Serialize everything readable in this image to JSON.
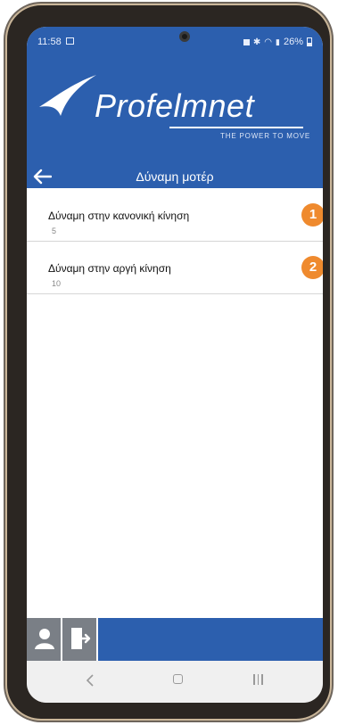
{
  "status": {
    "time": "11:58",
    "battery": "26%"
  },
  "brand": {
    "name": "Profelmnet",
    "tagline": "THE POWER TO MOVE"
  },
  "header": {
    "title": "Δύναμη μοτέρ"
  },
  "settings": [
    {
      "label": "Δύναμη στην κανονική κίνηση",
      "value": "5",
      "badge": "1"
    },
    {
      "label": "Δύναμη στην αργή κίνηση",
      "value": "10",
      "badge": "2"
    }
  ],
  "colors": {
    "primary": "#2c5fae",
    "badge": "#ef8a2e",
    "toolbar_button": "#7a7f86"
  },
  "icons": {
    "back": "arrow-left-icon",
    "user": "user-icon",
    "exit": "exit-door-icon"
  }
}
